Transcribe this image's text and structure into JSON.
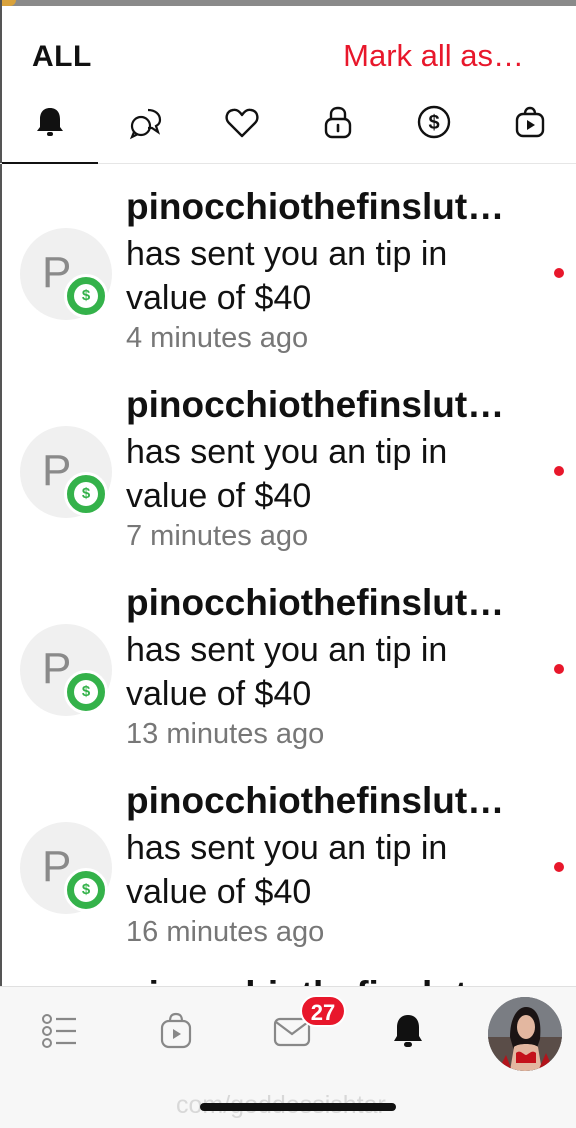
{
  "header": {
    "title": "ALL",
    "mark_all_label": "Mark all as…"
  },
  "tabs": [
    {
      "name": "bell-icon",
      "active": true
    },
    {
      "name": "chat-bubble-icon",
      "active": false
    },
    {
      "name": "heart-icon",
      "active": false
    },
    {
      "name": "lock-icon",
      "active": false
    },
    {
      "name": "dollar-icon",
      "active": false
    },
    {
      "name": "video-bag-icon",
      "active": false
    }
  ],
  "notifications": [
    {
      "initials": "P",
      "badge": "$",
      "username": "pinocchiothefinslut…",
      "message": " has sent you an tip in value of $40",
      "time": "4 minutes ago",
      "unread": true
    },
    {
      "initials": "P",
      "badge": "$",
      "username": "pinocchiothefinslut…",
      "message": " has sent you an tip in value of $40",
      "time": "7 minutes ago",
      "unread": true
    },
    {
      "initials": "P",
      "badge": "$",
      "username": "pinocchiothefinslut…",
      "message": " has sent you an tip in value of $40",
      "time": "13 minutes ago",
      "unread": true
    },
    {
      "initials": "P",
      "badge": "$",
      "username": "pinocchiothefinslut…",
      "message": " has sent you an tip in value of $40",
      "time": "16 minutes ago",
      "unread": true
    }
  ],
  "bottom_nav": {
    "items": [
      {
        "name": "feed-list-icon"
      },
      {
        "name": "video-bag-icon"
      },
      {
        "name": "mail-icon"
      },
      {
        "name": "notifications-bell-icon"
      }
    ],
    "messages_count": "27",
    "watermark": "com/goddessishtar"
  },
  "colors": {
    "accent": "#e8172b",
    "tip_badge": "#34b24a"
  }
}
